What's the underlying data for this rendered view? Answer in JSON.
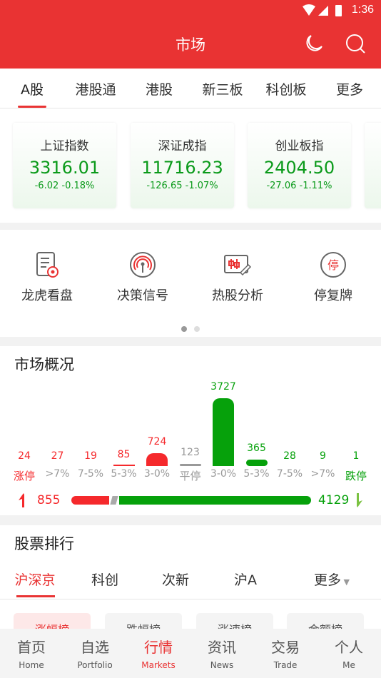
{
  "status_bar": {
    "time": "1:36"
  },
  "header": {
    "title": "市场",
    "icons": [
      "moon-icon",
      "search-icon"
    ]
  },
  "tabs": [
    {
      "label": "A股",
      "active": true
    },
    {
      "label": "港股通"
    },
    {
      "label": "港股"
    },
    {
      "label": "新三板"
    },
    {
      "label": "科创板"
    },
    {
      "label": "更多"
    }
  ],
  "indices": [
    {
      "name": "上证指数",
      "value": "3316.01",
      "change": "-6.02",
      "pct": "-0.18%"
    },
    {
      "name": "深证成指",
      "value": "11716.23",
      "change": "-126.65",
      "pct": "-1.07%"
    },
    {
      "name": "创业板指",
      "value": "2404.50",
      "change": "-27.06",
      "pct": "-1.11%"
    }
  ],
  "tools": [
    {
      "label": "龙虎看盘",
      "icon": "document-badge-icon"
    },
    {
      "label": "决策信号",
      "icon": "signal-antenna-icon"
    },
    {
      "label": "热股分析",
      "icon": "candlestick-edit-icon"
    },
    {
      "label": "停复牌",
      "icon": "suspend-icon",
      "glyph": "停"
    }
  ],
  "overview": {
    "title": "市场概况",
    "columns": [
      {
        "label": "涨停",
        "value": 24,
        "kind": "up",
        "strong": true
      },
      {
        "label": ">7%",
        "value": 27,
        "kind": "up"
      },
      {
        "label": "7-5%",
        "value": 19,
        "kind": "up"
      },
      {
        "label": "5-3%",
        "value": 85,
        "kind": "up"
      },
      {
        "label": "3-0%",
        "value": 724,
        "kind": "up"
      },
      {
        "label": "平停",
        "value": 123,
        "kind": "flat",
        "strong": true
      },
      {
        "label": "3-0%",
        "value": 3727,
        "kind": "down"
      },
      {
        "label": "5-3%",
        "value": 365,
        "kind": "down"
      },
      {
        "label": "7-5%",
        "value": 28,
        "kind": "down"
      },
      {
        "label": ">7%",
        "value": 9,
        "kind": "down"
      },
      {
        "label": "跌停",
        "value": 1,
        "kind": "down",
        "strong": true
      }
    ],
    "up_total": "855",
    "down_total": "4129",
    "flat_total": 123,
    "colors": {
      "up": "#f5292c",
      "down": "#06a10b",
      "flat": "#999999"
    }
  },
  "ranking": {
    "title": "股票排行",
    "tabs": [
      {
        "label": "沪深京",
        "active": true
      },
      {
        "label": "科创"
      },
      {
        "label": "次新"
      },
      {
        "label": "沪A"
      },
      {
        "label": "更多"
      }
    ],
    "chips": [
      {
        "label": "涨幅榜",
        "active": true
      },
      {
        "label": "跌幅榜"
      },
      {
        "label": "涨速榜"
      },
      {
        "label": "金额榜"
      }
    ]
  },
  "nav": [
    {
      "zh": "首页",
      "en": "Home"
    },
    {
      "zh": "自选",
      "en": "Portfolio"
    },
    {
      "zh": "行情",
      "en": "Markets",
      "active": true
    },
    {
      "zh": "资讯",
      "en": "News"
    },
    {
      "zh": "交易",
      "en": "Trade"
    },
    {
      "zh": "个人",
      "en": "Me"
    }
  ]
}
